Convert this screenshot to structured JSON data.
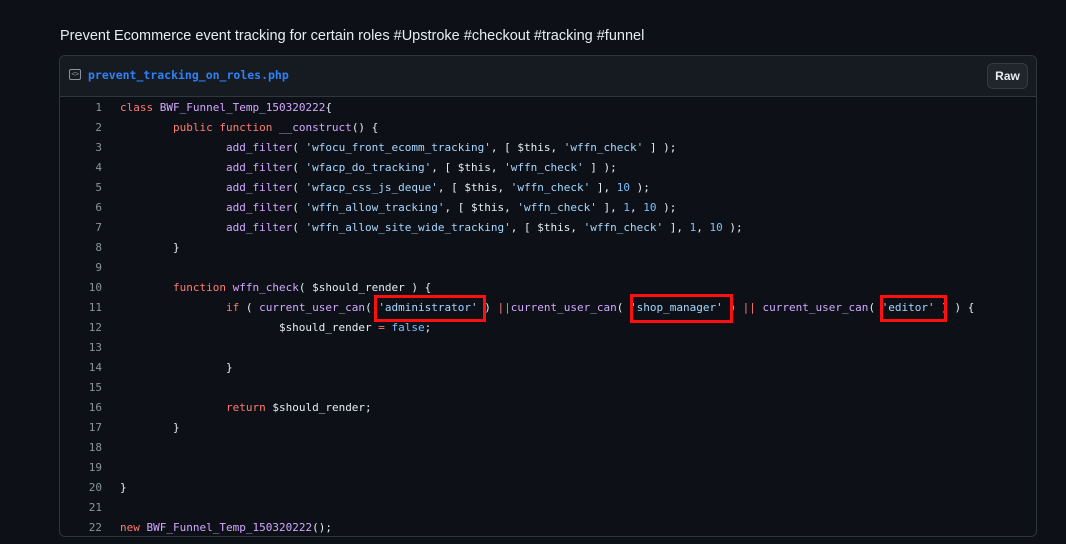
{
  "description": "Prevent Ecommerce event tracking for certain roles #Upstroke #checkout #tracking #funnel",
  "file": {
    "icon": "code-file-icon",
    "name": "prevent_tracking_on_roles.php",
    "raw_label": "Raw"
  },
  "code": {
    "lines": [
      {
        "n": "1",
        "t": [
          [
            "k",
            "class "
          ],
          [
            "f",
            "BWF_Funnel_Temp_150320222"
          ],
          [
            "",
            "{"
          ]
        ]
      },
      {
        "n": "2",
        "t": [
          [
            "",
            "        "
          ],
          [
            "k",
            "public function "
          ],
          [
            "f",
            "__construct"
          ],
          [
            "",
            "() {"
          ]
        ]
      },
      {
        "n": "3",
        "t": [
          [
            "",
            "                "
          ],
          [
            "f",
            "add_filter"
          ],
          [
            "",
            "( "
          ],
          [
            "s",
            "'wfocu_front_ecomm_tracking'"
          ],
          [
            "",
            ", [ $this, "
          ],
          [
            "s",
            "'wffn_check'"
          ],
          [
            "",
            " ] );"
          ]
        ]
      },
      {
        "n": "4",
        "t": [
          [
            "",
            "                "
          ],
          [
            "f",
            "add_filter"
          ],
          [
            "",
            "( "
          ],
          [
            "s",
            "'wfacp_do_tracking'"
          ],
          [
            "",
            ", [ $this, "
          ],
          [
            "s",
            "'wffn_check'"
          ],
          [
            "",
            " ] );"
          ]
        ]
      },
      {
        "n": "5",
        "t": [
          [
            "",
            "                "
          ],
          [
            "f",
            "add_filter"
          ],
          [
            "",
            "( "
          ],
          [
            "s",
            "'wfacp_css_js_deque'"
          ],
          [
            "",
            ", [ $this, "
          ],
          [
            "s",
            "'wffn_check'"
          ],
          [
            "",
            " ], "
          ],
          [
            "c",
            "10"
          ],
          [
            "",
            " );"
          ]
        ]
      },
      {
        "n": "6",
        "t": [
          [
            "",
            "                "
          ],
          [
            "f",
            "add_filter"
          ],
          [
            "",
            "( "
          ],
          [
            "s",
            "'wffn_allow_tracking'"
          ],
          [
            "",
            ", [ $this, "
          ],
          [
            "s",
            "'wffn_check'"
          ],
          [
            "",
            " ], "
          ],
          [
            "c",
            "1"
          ],
          [
            "",
            ", "
          ],
          [
            "c",
            "10"
          ],
          [
            "",
            " );"
          ]
        ]
      },
      {
        "n": "7",
        "t": [
          [
            "",
            "                "
          ],
          [
            "f",
            "add_filter"
          ],
          [
            "",
            "( "
          ],
          [
            "s",
            "'wffn_allow_site_wide_tracking'"
          ],
          [
            "",
            ", [ $this, "
          ],
          [
            "s",
            "'wffn_check'"
          ],
          [
            "",
            " ], "
          ],
          [
            "c",
            "1"
          ],
          [
            "",
            ", "
          ],
          [
            "c",
            "10"
          ],
          [
            "",
            " );"
          ]
        ]
      },
      {
        "n": "8",
        "t": [
          [
            "",
            "        }"
          ]
        ]
      },
      {
        "n": "9",
        "t": []
      },
      {
        "n": "10",
        "t": [
          [
            "",
            "        "
          ],
          [
            "k",
            "function "
          ],
          [
            "f",
            "wffn_check"
          ],
          [
            "",
            "( $should_render ) {"
          ]
        ]
      },
      {
        "n": "11",
        "t": [
          [
            "",
            "                "
          ],
          [
            "k",
            "if"
          ],
          [
            "",
            " ( "
          ],
          [
            "f",
            "current_user_can"
          ],
          [
            "",
            "( "
          ],
          [
            "s",
            "'administrator'"
          ],
          [
            "",
            " ) "
          ],
          [
            "k",
            "||"
          ],
          [
            "",
            "",
            " "
          ],
          [
            "f",
            "current_user_can"
          ],
          [
            "",
            "( "
          ],
          [
            "s",
            "'shop_manager'"
          ],
          [
            "",
            " ) "
          ],
          [
            "k",
            "||"
          ],
          [
            "",
            " "
          ],
          [
            "f",
            "current_user_can"
          ],
          [
            "",
            "( "
          ],
          [
            "s",
            "'editor'"
          ],
          [
            "",
            " ) ) {"
          ]
        ]
      },
      {
        "n": "12",
        "t": [
          [
            "",
            "                        $should_render "
          ],
          [
            "k",
            "="
          ],
          [
            "",
            " "
          ],
          [
            "c",
            "false"
          ],
          [
            "",
            ";"
          ]
        ]
      },
      {
        "n": "13",
        "t": []
      },
      {
        "n": "14",
        "t": [
          [
            "",
            "                }"
          ]
        ]
      },
      {
        "n": "15",
        "t": []
      },
      {
        "n": "16",
        "t": [
          [
            "",
            "                "
          ],
          [
            "k",
            "return"
          ],
          [
            "",
            " $should_render;"
          ]
        ]
      },
      {
        "n": "17",
        "t": [
          [
            "",
            "        }"
          ]
        ]
      },
      {
        "n": "18",
        "t": []
      },
      {
        "n": "19",
        "t": []
      },
      {
        "n": "20",
        "t": [
          [
            "",
            "}"
          ]
        ]
      },
      {
        "n": "21",
        "t": []
      },
      {
        "n": "22",
        "t": [
          [
            "k",
            "new "
          ],
          [
            "f",
            "BWF_Funnel_Temp_150320222"
          ],
          [
            "",
            "();"
          ]
        ]
      }
    ]
  },
  "colors": {
    "keyword": "#ff7b72",
    "function": "#d2a8ff",
    "string": "#a5d6ff",
    "constant": "#79c0ff",
    "highlight_box": "#ff1010"
  }
}
